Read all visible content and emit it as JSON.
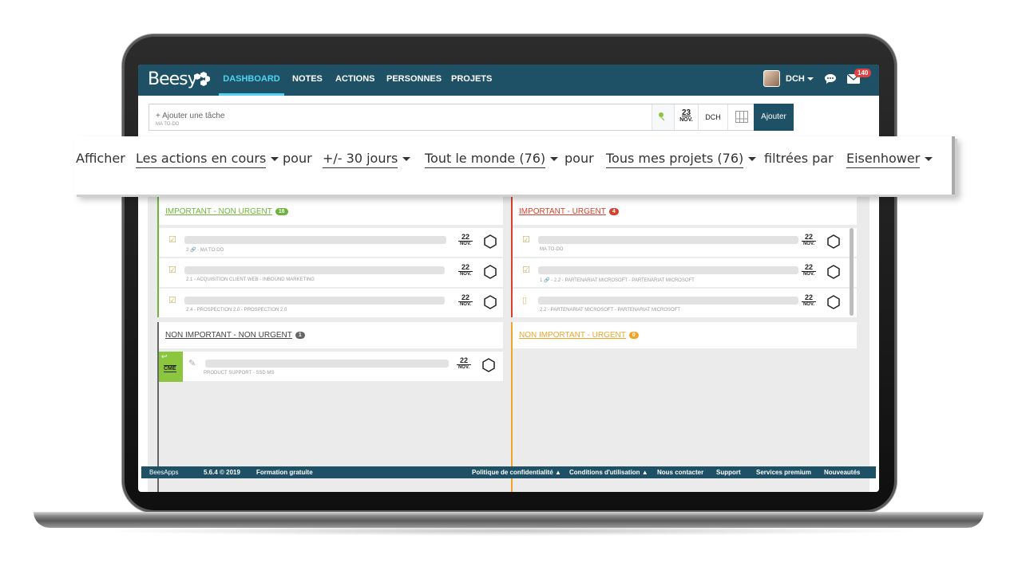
{
  "app": {
    "logo": "Beesy",
    "nav": [
      "DASHBOARD",
      "NOTES",
      "ACTIONS",
      "PERSONNES",
      "PROJETS"
    ],
    "user": "DCH",
    "mail_count": "140"
  },
  "taskbar": {
    "placeholder": "+ Ajouter une tâche",
    "subtext": "MA TO-DO",
    "date_day": "23",
    "date_month": "NOV.",
    "owner": "DCH",
    "add_label": "Ajouter"
  },
  "filters": {
    "show_label": "Afficher",
    "actions": "Les actions en cours",
    "for1": "pour",
    "period": "+/- 30 jours",
    "people": "Tout le monde (76)",
    "for2": "pour",
    "projects": "Tous mes projets (76)",
    "filtered_by": "filtrées par",
    "method": "Eisenhower"
  },
  "quadrants": {
    "iu": {
      "title": "IMPORTANT - URGENT",
      "count": "4",
      "color": "#d9402b",
      "rows": [
        {
          "meta": "MA TO-DO",
          "day": "22",
          "month": "NOV."
        },
        {
          "meta": "1 🔗 - 2.2 - PARTENARIAT MICROSOFT - PARTENARIAT MICROSOFT",
          "day": "22",
          "month": "NOV."
        },
        {
          "meta": "2.2 - PARTENARIAT MICROSOFT - PARTENARIAT MICROSOFT",
          "day": "22",
          "month": "NOV."
        }
      ]
    },
    "inu": {
      "title": "IMPORTANT - NON URGENT",
      "count": "16",
      "color": "#6fb43a",
      "rows": [
        {
          "meta": "2 🔗 - MA TO-DO",
          "day": "22",
          "month": "NOV."
        },
        {
          "meta": "2.1 - ACQUISITION CLIENT WEB - INBOUND MARKETING",
          "day": "22",
          "month": "NOV."
        },
        {
          "meta": "2.4 - PROSPECTION 2.0 - PROSPECTION 2.0",
          "day": "22",
          "month": "NOV."
        }
      ]
    },
    "niu": {
      "title": "NON IMPORTANT - URGENT",
      "count": "0",
      "color": "#f0a52a",
      "rows": []
    },
    "ninu": {
      "title": "NON IMPORTANT - NON URGENT",
      "count": "1",
      "color": "#555555",
      "rows": [
        {
          "meta": "PRODUCT SUPPORT - SSD MS",
          "day": "22",
          "month": "NOV.",
          "tag": "CME"
        }
      ]
    }
  },
  "footer": {
    "brand": "BeesApps",
    "version": "5.6.4 © 2019",
    "training": "Formation gratuite",
    "privacy": "Politique de confidentialité ▲",
    "terms": "Conditions d'utilisation ▲",
    "contact": "Nous contacter",
    "support": "Support",
    "premium": "Services premium",
    "news": "Nouveautés"
  }
}
